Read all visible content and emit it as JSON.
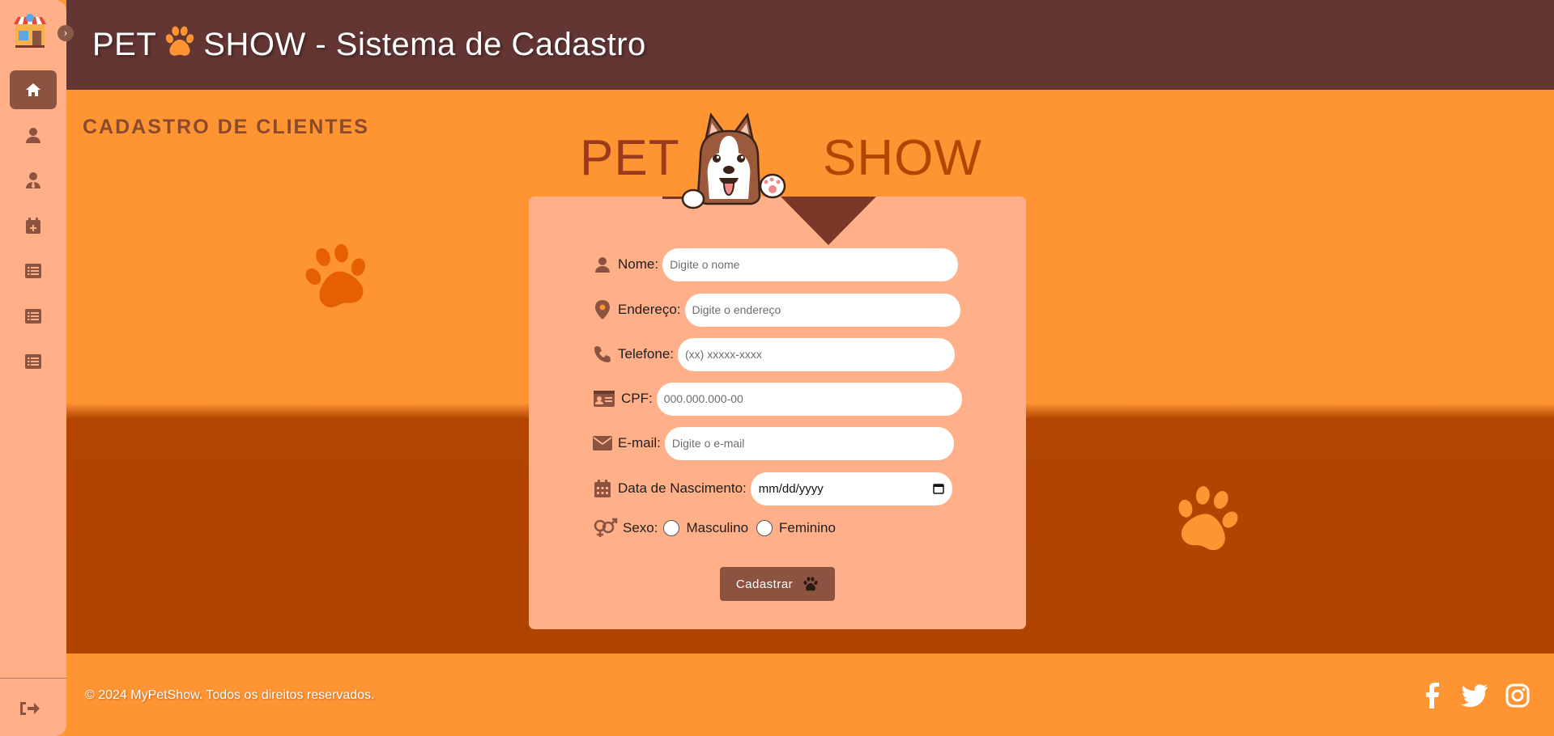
{
  "header": {
    "title_left": "PET",
    "title_right": "SHOW - Sistema de Cadastro"
  },
  "sidebar": {
    "items": [
      {
        "icon": "home-icon",
        "active": true
      },
      {
        "icon": "user-icon",
        "active": false
      },
      {
        "icon": "employee-icon",
        "active": false
      },
      {
        "icon": "calendar-plus-icon",
        "active": false
      },
      {
        "icon": "list-icon",
        "active": false
      },
      {
        "icon": "list-icon",
        "active": false
      },
      {
        "icon": "list-icon",
        "active": false
      }
    ],
    "toggle": "›"
  },
  "page": {
    "heading": "CADASTRO DE CLIENTES",
    "logo_left": "PET",
    "logo_right": "SHOW"
  },
  "form": {
    "nome": {
      "label": "Nome:",
      "placeholder": "Digite o nome"
    },
    "endereco": {
      "label": "Endereço:",
      "placeholder": "Digite o endereço"
    },
    "telefone": {
      "label": "Telefone:",
      "placeholder": "(xx) xxxxx-xxxx"
    },
    "cpf": {
      "label": "CPF:",
      "placeholder": "000.000.000-00"
    },
    "email": {
      "label": "E-mail:",
      "placeholder": "Digite o e-mail"
    },
    "nascimento": {
      "label": "Data de Nascimento:",
      "value": "mm/dd/yyyy"
    },
    "sexo": {
      "label": "Sexo:",
      "options": [
        "Masculino",
        "Feminino"
      ]
    },
    "submit_label": "Cadastrar"
  },
  "footer": {
    "copyright": "© 2024 MyPetShow. Todos os direitos reservados."
  },
  "colors": {
    "header": "#633533",
    "background": "#ff9433",
    "lower_band": "#b04300",
    "sidebar": "#ffb088",
    "card": "#ffb088",
    "button": "#8b5340"
  }
}
